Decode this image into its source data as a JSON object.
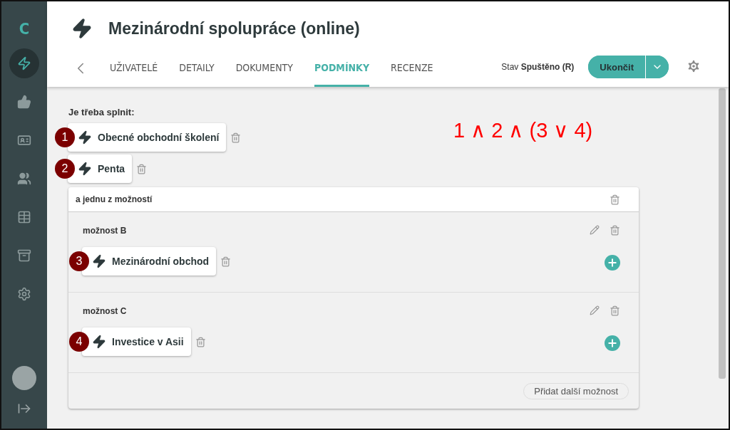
{
  "sidebar": {
    "logo": "C",
    "items": [
      {
        "kind": "lightning",
        "selected": true
      },
      {
        "kind": "thumb",
        "selected": false
      },
      {
        "kind": "certificate",
        "selected": false
      },
      {
        "kind": "users",
        "selected": false
      },
      {
        "kind": "table",
        "selected": false
      },
      {
        "kind": "archive",
        "selected": false
      },
      {
        "kind": "gear",
        "selected": false
      }
    ]
  },
  "header": {
    "title": "Mezinárodní spolupráce (online)",
    "tabs": [
      {
        "label": "UŽIVATELÉ",
        "selected": false
      },
      {
        "label": "DETAILY",
        "selected": false
      },
      {
        "label": "DOKUMENTY",
        "selected": false
      },
      {
        "label": "PODMÍNKY",
        "selected": true
      },
      {
        "label": "RECENZE",
        "selected": false
      }
    ],
    "status_label": "Stav",
    "status_value": "Spuštěno (R)",
    "action_button": "Ukončit"
  },
  "content": {
    "section_label": "Je třeba splnit:",
    "formula": "1 ∧ 2 ∧ (3 ∨ 4)",
    "conditions": [
      {
        "marker": "1",
        "label": "Obecné obchodní školení"
      },
      {
        "marker": "2",
        "label": "Penta"
      }
    ],
    "group": {
      "title": "a jednu z možností",
      "options": [
        {
          "title": "možnost B",
          "conditions": [
            {
              "marker": "3",
              "label": "Mezinárodní obchod"
            }
          ]
        },
        {
          "title": "možnost C",
          "conditions": [
            {
              "marker": "4",
              "label": "Investice v Asii"
            }
          ]
        }
      ],
      "add_button": "Přidat další možnost"
    }
  }
}
